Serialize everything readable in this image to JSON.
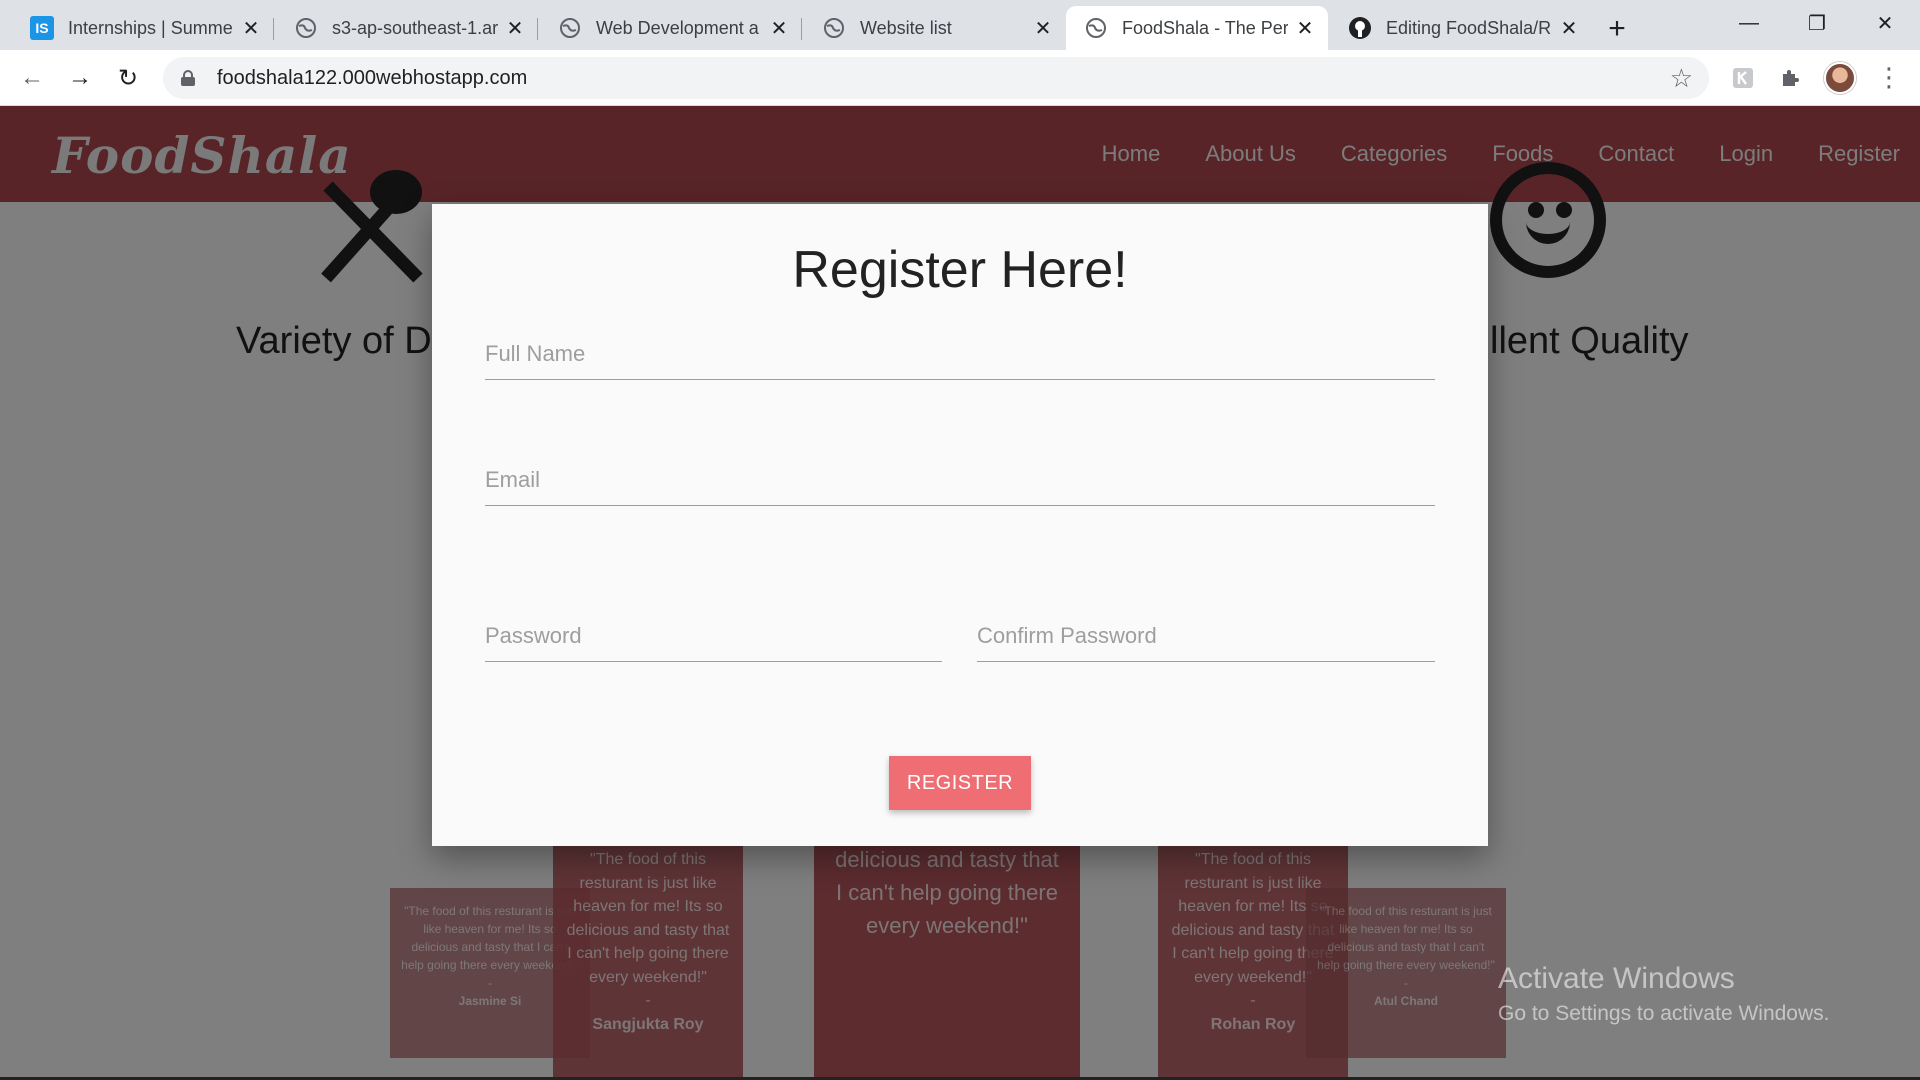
{
  "browser": {
    "tabs": [
      {
        "icon": "internshala-icon",
        "favicon_text": "IS",
        "title": "Internships | Summer",
        "active": false
      },
      {
        "icon": "globe-icon",
        "title": "s3-ap-southeast-1.ar",
        "active": false
      },
      {
        "icon": "globe-icon",
        "title": "Web Development a",
        "active": false
      },
      {
        "icon": "globe-icon",
        "title": "Website list",
        "active": false
      },
      {
        "icon": "globe-icon",
        "title": "FoodShala - The Perf",
        "active": true
      },
      {
        "icon": "github-icon",
        "title": "Editing FoodShala/R",
        "active": false
      }
    ],
    "url": "foodshala122.000webhostapp.com"
  },
  "site": {
    "brand": "FoodShala",
    "nav": [
      "Home",
      "About Us",
      "Categories",
      "Foods",
      "Contact",
      "Login",
      "Register"
    ],
    "features": {
      "left_title": "Variety of Di",
      "right_title": "llent Quality"
    }
  },
  "modal": {
    "title": "Register Here!",
    "full_name_placeholder": "Full Name",
    "email_placeholder": "Email",
    "password_placeholder": "Password",
    "confirm_password_placeholder": "Confirm Password",
    "button_label": "REGISTER"
  },
  "testimonials": [
    {
      "quote": "\"The food of this resturant is just like heaven for me! Its so delicious and tasty that I can't help going there every weekend!\"",
      "dash": "-",
      "author": "Jasmine Si"
    },
    {
      "quote": "\"The food of this resturant is just like heaven for me! Its so delicious and tasty that I can't help going there every weekend!\"",
      "dash": "-",
      "author": "Sangjukta Roy"
    },
    {
      "quote": "\"The food of this resturant is just like heaven for me! Its so delicious and tasty that I can't help going there every weekend!\"",
      "dash": "",
      "author": ""
    },
    {
      "quote": "\"The food of this resturant is just like heaven for me! Its so delicious and tasty that I can't help going there every weekend!\"",
      "dash": "-",
      "author": "Rohan Roy"
    },
    {
      "quote": "\"The food of this resturant is just like heaven for me! Its so delicious and tasty that I can't help going there every weekend!\"",
      "dash": "-",
      "author": "Atul Chand"
    }
  ],
  "os": {
    "activate_title": "Activate Windows",
    "activate_subtitle": "Go to Settings to activate Windows."
  },
  "colors": {
    "navbar": "#b04850",
    "button": "#ee6e73",
    "tab_strip": "#dee1e6"
  }
}
